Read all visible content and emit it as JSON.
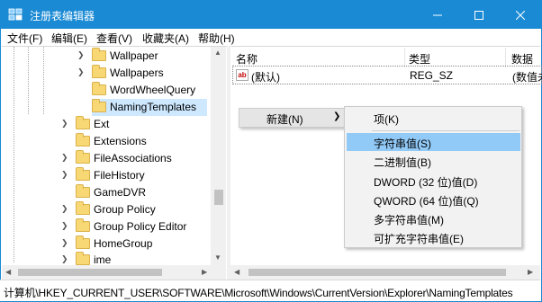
{
  "window": {
    "title": "注册表编辑器",
    "controls": {
      "minimize": "minimize",
      "maximize": "maximize",
      "close": "close"
    }
  },
  "menubar": {
    "items": [
      {
        "label": "文件(F)"
      },
      {
        "label": "编辑(E)"
      },
      {
        "label": "查看(V)"
      },
      {
        "label": "收藏夹(A)"
      },
      {
        "label": "帮助(H)"
      }
    ]
  },
  "tree": {
    "items": [
      {
        "label": "Wallpaper",
        "expandable": true,
        "selected": false
      },
      {
        "label": "Wallpapers",
        "expandable": true,
        "selected": false
      },
      {
        "label": "WordWheelQuery",
        "expandable": false,
        "selected": false
      },
      {
        "label": "NamingTemplates",
        "expandable": false,
        "selected": true
      },
      {
        "label": "Ext",
        "expandable": true,
        "selected": false
      },
      {
        "label": "Extensions",
        "expandable": false,
        "selected": false
      },
      {
        "label": "FileAssociations",
        "expandable": true,
        "selected": false
      },
      {
        "label": "FileHistory",
        "expandable": true,
        "selected": false
      },
      {
        "label": "GameDVR",
        "expandable": false,
        "selected": false
      },
      {
        "label": "Group Policy",
        "expandable": true,
        "selected": false
      },
      {
        "label": "Group Policy Editor",
        "expandable": true,
        "selected": false
      },
      {
        "label": "HomeGroup",
        "expandable": true,
        "selected": false
      },
      {
        "label": "ime",
        "expandable": true,
        "selected": false
      }
    ]
  },
  "list": {
    "columns": [
      {
        "label": "名称"
      },
      {
        "label": "类型"
      },
      {
        "label": "数据"
      }
    ],
    "rows": [
      {
        "name": "(默认)",
        "type": "REG_SZ",
        "data": "(数值未"
      }
    ]
  },
  "context_menu": {
    "new_label": "新建(N)",
    "submenu": [
      {
        "label": "项(K)",
        "highlighted": false
      },
      {
        "label": "字符串值(S)",
        "highlighted": true
      },
      {
        "label": "二进制值(B)",
        "highlighted": false
      },
      {
        "label": "DWORD (32 位)值(D)",
        "highlighted": false
      },
      {
        "label": "QWORD (64 位)值(Q)",
        "highlighted": false
      },
      {
        "label": "多字符串值(M)",
        "highlighted": false
      },
      {
        "label": "可扩充字符串值(E)",
        "highlighted": false
      }
    ]
  },
  "statusbar": {
    "path": "计算机\\HKEY_CURRENT_USER\\SOFTWARE\\Microsoft\\Windows\\CurrentVersion\\Explorer\\NamingTemplates"
  },
  "colors": {
    "titlebar": "#1a8ad4",
    "selection": "#cde8ff",
    "menu_highlight": "#91c9f7",
    "folder": "#f8d775",
    "reg_icon_text": "#c00000"
  }
}
